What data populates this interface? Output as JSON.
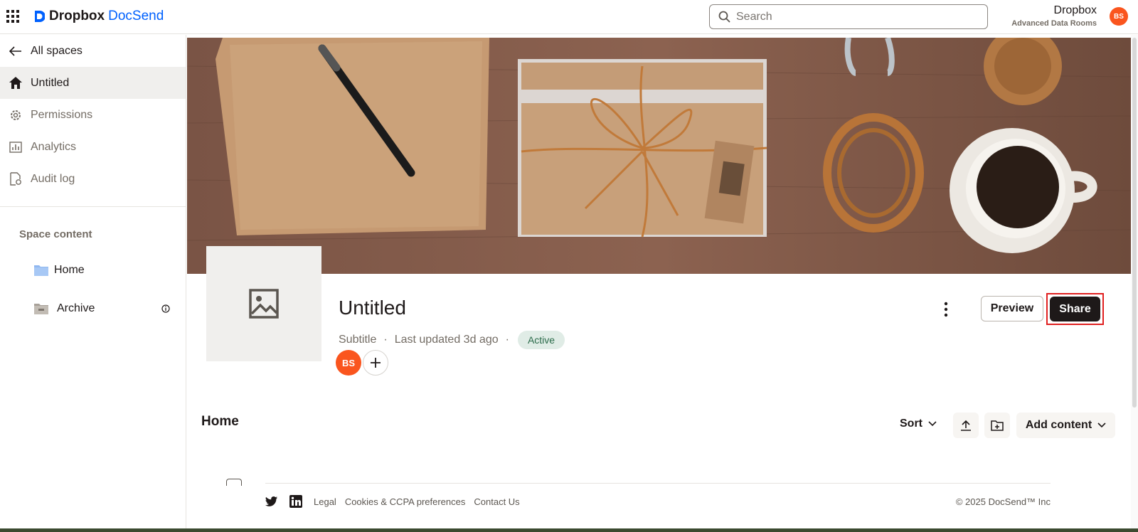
{
  "header": {
    "brand_primary": "Dropbox",
    "brand_secondary": "DocSend",
    "search_placeholder": "Search",
    "org_name": "Dropbox",
    "org_plan": "Advanced Data Rooms",
    "avatar_initials": "BS",
    "avatar_color": "#fa551e"
  },
  "sidebar": {
    "back_label": "All spaces",
    "items": [
      {
        "label": "Untitled",
        "icon": "home-icon",
        "active": true
      },
      {
        "label": "Permissions",
        "icon": "gear-icon"
      },
      {
        "label": "Analytics",
        "icon": "chart-icon"
      },
      {
        "label": "Audit log",
        "icon": "audit-log-icon"
      }
    ],
    "space_content_heading": "Space content",
    "tree": [
      {
        "label": "Home",
        "icon": "folder-icon"
      },
      {
        "label": "Archive",
        "icon": "archive-icon"
      }
    ]
  },
  "space": {
    "title": "Untitled",
    "subtitle": "Subtitle",
    "updated": "Last updated 3d ago",
    "status": "Active",
    "member_initials": "BS",
    "preview_label": "Preview",
    "share_label": "Share"
  },
  "content": {
    "section_title": "Home",
    "sort_label": "Sort",
    "add_content_label": "Add content"
  },
  "footer": {
    "links": [
      "Legal",
      "Cookies & CCPA preferences",
      "Contact Us"
    ],
    "copyright": "© 2025 DocSend™ Inc"
  },
  "colors": {
    "accent": "#0061fe",
    "share_button": "#1e1919",
    "status_badge_bg": "#e0ece6"
  }
}
